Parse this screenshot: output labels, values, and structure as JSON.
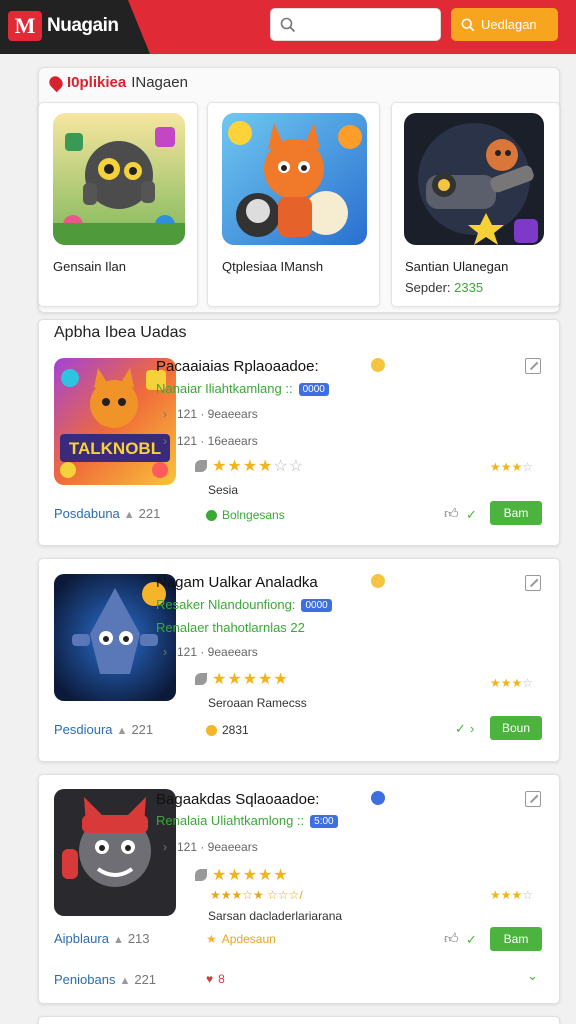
{
  "header": {
    "logo_mark": "M",
    "logo_text": "Nuagain",
    "search_placeholder": "",
    "button_label": "Uedlagan"
  },
  "featured": {
    "title_strong": "I0plikiea",
    "title_rest": "INagaen",
    "items": [
      {
        "name": "Gensain Ilan",
        "sub": ""
      },
      {
        "name": "Qtplesiaa IMansh",
        "sub": ""
      },
      {
        "name": "Santian Ulanegan",
        "sub_label": "Sepder:",
        "sub_value": "2335"
      }
    ]
  },
  "section_title": "Apbha Ibea Uadas",
  "apps": [
    {
      "title": "Pacaaiaias Rplaoaadoe:",
      "dev": "Nanaiar Iliahtkamlang ::",
      "chip": "0000",
      "meta1": "121 · 9eaeears",
      "meta2": "121 · 16eaears",
      "rating": 4,
      "side_text": "Sesia",
      "rating_small": 3,
      "left_link": "Posdabuna",
      "left_num": "221",
      "status": "Bolngesans",
      "btn": "Bam",
      "icon_text": "TALKNOBL"
    },
    {
      "title": "Nagam Ualkar Analadka",
      "dev": "Resaker Nlandounfiong:",
      "chip": "0000",
      "dev2": "Renalaer thahotlarnlas 22",
      "meta1": "121 · 9eaeears",
      "rating": 5,
      "side_text": "Seroaan Ramecss",
      "rating_small": 3,
      "left_link": "Pesdioura",
      "left_num": "221",
      "status": "2831",
      "btn": "Boun"
    },
    {
      "title": "Bagaakdas Sqlaoaadoe:",
      "dev": "Renalaia Uliahtkamlong ::",
      "chip": "5:00",
      "meta1": "121 · 9eaeears",
      "rating": 5,
      "rating_tiny": "★★★☆★ ☆☆☆/",
      "side_text": "Sarsan dacladerlariarana",
      "rating_small": 3,
      "left_link": "Aipblaura",
      "left_num": "213",
      "status": "Apdesaun",
      "btn": "Bam",
      "left_link2": "Peniobans",
      "left_num2": "221",
      "extra": "8"
    }
  ],
  "colors": {
    "brand": "#e02a36",
    "accent": "#f7a51f",
    "green": "#4bb33e",
    "link": "#2b6cb0"
  }
}
